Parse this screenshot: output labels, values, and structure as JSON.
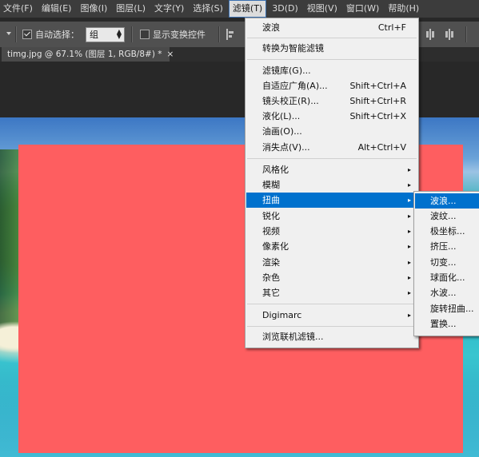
{
  "menubar": {
    "items": [
      "文件(F)",
      "编辑(E)",
      "图像(I)",
      "图层(L)",
      "文字(Y)",
      "选择(S)",
      "滤镜(T)",
      "3D(D)",
      "视图(V)",
      "窗口(W)",
      "帮助(H)"
    ],
    "active_index": 6
  },
  "options": {
    "auto_select_label": "自动选择：",
    "auto_select_checked": true,
    "auto_select_value": "组",
    "show_transform_label": "显示变换控件",
    "show_transform_checked": false
  },
  "document_tab": {
    "title": "timg.jpg @ 67.1% (图层 1, RGB/8#) *",
    "close": "×"
  },
  "filter_menu": {
    "items": [
      {
        "label": "波浪",
        "shortcut": "Ctrl+F"
      },
      {
        "label": "转换为智能滤镜"
      },
      {
        "label": "滤镜库(G)..."
      },
      {
        "label": "自适应广角(A)...",
        "shortcut": "Shift+Ctrl+A"
      },
      {
        "label": "镜头校正(R)...",
        "shortcut": "Shift+Ctrl+R"
      },
      {
        "label": "液化(L)...",
        "shortcut": "Shift+Ctrl+X"
      },
      {
        "label": "油画(O)..."
      },
      {
        "label": "消失点(V)...",
        "shortcut": "Alt+Ctrl+V"
      },
      {
        "label": "风格化"
      },
      {
        "label": "模糊"
      },
      {
        "label": "扭曲"
      },
      {
        "label": "锐化"
      },
      {
        "label": "视频"
      },
      {
        "label": "像素化"
      },
      {
        "label": "渲染"
      },
      {
        "label": "杂色"
      },
      {
        "label": "其它"
      },
      {
        "label": "Digimarc"
      },
      {
        "label": "浏览联机滤镜..."
      }
    ],
    "highlighted": "扭曲",
    "submenu_arrow": "▸"
  },
  "distort_submenu": {
    "items": [
      "波浪...",
      "波纹...",
      "极坐标...",
      "挤压...",
      "切变...",
      "球面化...",
      "水波...",
      "旋转扭曲...",
      "置换..."
    ],
    "highlighted": "波浪..."
  },
  "colors": {
    "highlight": "#0071cd",
    "canvas_fill": "#fe5e60",
    "menu_bg": "#f0f0f0"
  }
}
